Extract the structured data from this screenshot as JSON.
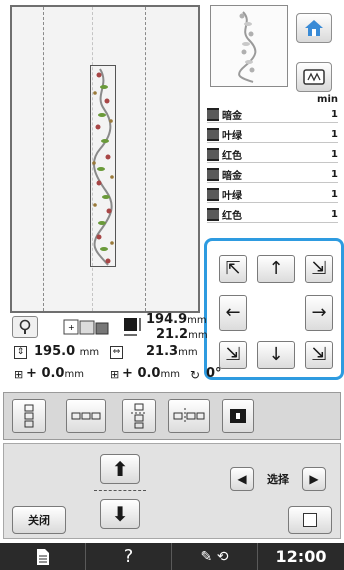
{
  "preview": {
    "hoop_guides": true
  },
  "thread_list": {
    "unit_label": "min",
    "items": [
      {
        "name": "暗金",
        "value": "1"
      },
      {
        "name": "叶绿",
        "value": "1"
      },
      {
        "name": "红色",
        "value": "1"
      },
      {
        "name": "暗金",
        "value": "1"
      },
      {
        "name": "叶绿",
        "value": "1"
      },
      {
        "name": "红色",
        "value": "1"
      }
    ]
  },
  "info": {
    "design_height": "194.9",
    "design_width": "21.2",
    "hoop_height": "195.0",
    "hoop_width": "21.3",
    "offset_x": "0.0",
    "offset_y": "0.0",
    "angle": "0°",
    "unit": "mm",
    "sign_x": "+",
    "sign_y": "+"
  },
  "controls": {
    "select_label": "选择",
    "close_label": "关闭"
  },
  "status": {
    "time": "12:00",
    "help": "?"
  },
  "colors": {
    "accent": "#2e9be0",
    "statusbar": "#2a2a2a"
  }
}
